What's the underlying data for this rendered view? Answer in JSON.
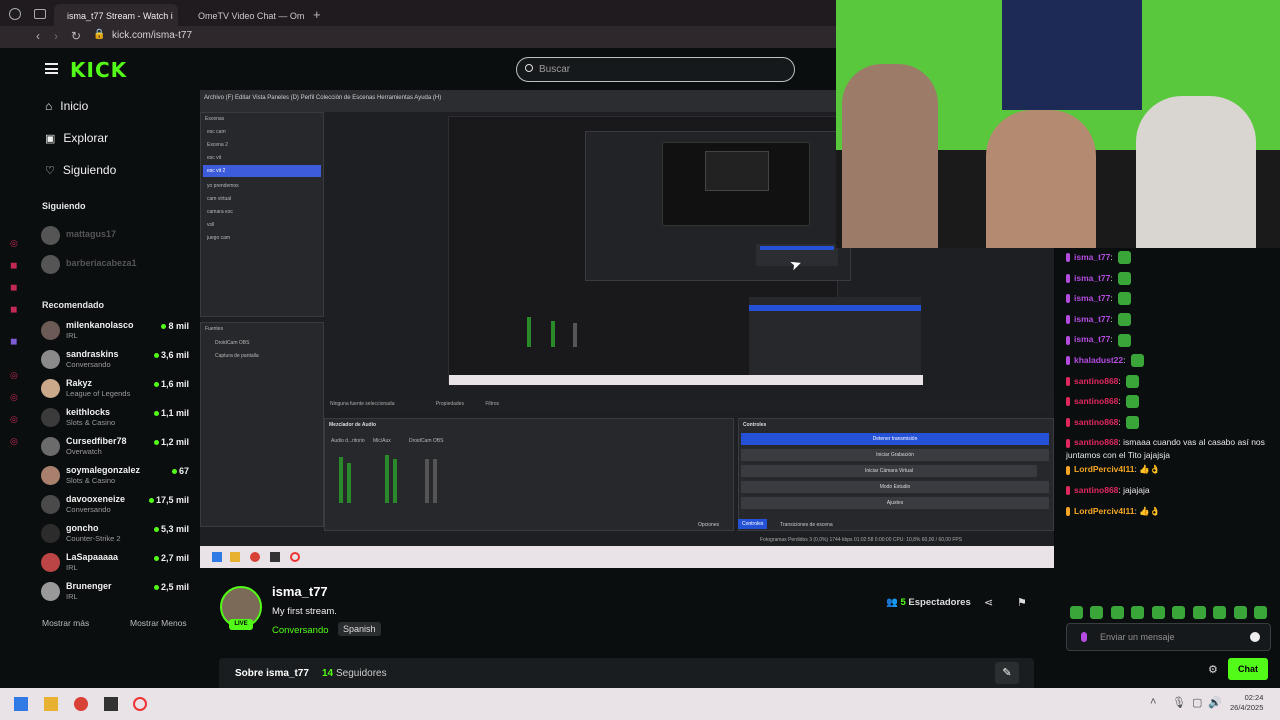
{
  "browser": {
    "tabs": [
      {
        "label": "isma_t77 Stream - Watch i",
        "active": true
      },
      {
        "label": "OmeTV Video Chat — Om",
        "active": false
      }
    ],
    "url": "kick.com/isma-t77"
  },
  "kick": {
    "search_placeholder": "Buscar",
    "nav": [
      {
        "label": "Inicio",
        "icon": "home-icon"
      },
      {
        "label": "Explorar",
        "icon": "compass-icon"
      },
      {
        "label": "Siguiendo",
        "icon": "heart-icon"
      }
    ],
    "following_title": "Siguiendo",
    "following": [
      "mattagus17",
      "barberiacabeza1"
    ],
    "recommended_title": "Recomendado",
    "recommended": [
      {
        "name": "milenkanolasco",
        "category": "IRL",
        "viewers": "8 mil"
      },
      {
        "name": "sandraskins",
        "category": "Conversando",
        "viewers": "3,6 mil"
      },
      {
        "name": "Rakyz",
        "category": "League of Legends",
        "viewers": "1,6 mil"
      },
      {
        "name": "keithlocks",
        "category": "Slots & Casino",
        "viewers": "1,1 mil"
      },
      {
        "name": "Cursedfiber78",
        "category": "Overwatch",
        "viewers": "1,2 mil"
      },
      {
        "name": "soymalegonzalez",
        "category": "Slots & Casino",
        "viewers": "67"
      },
      {
        "name": "davooxeneize",
        "category": "Conversando",
        "viewers": "17,5 mil"
      },
      {
        "name": "goncho",
        "category": "Counter-Strike 2",
        "viewers": "5,3 mil"
      },
      {
        "name": "LaSapaaaaa",
        "category": "IRL",
        "viewers": "2,7 mil"
      },
      {
        "name": "Brunenger",
        "category": "IRL",
        "viewers": "2,5 mil"
      }
    ],
    "show_more": "Mostrar más",
    "show_less": "Mostrar Menos",
    "accent": "#53fc18"
  },
  "obs": {
    "menu": "Archivo (F)   Editar   Vista   Paneles (D)   Perfil   Colección de Escenas   Herramientas   Ayuda (H)",
    "scenes_title": "Escenas",
    "scenes": [
      "esc cam",
      "Escena 2",
      "esc vit",
      "esc vit 2",
      "yo prendemos",
      "cam virtual",
      "camara esc",
      "vsll",
      "juego cam"
    ],
    "selected_scene": "esc vit 2",
    "sources_title": "Fuentes",
    "sources": [
      "DroidCam OBS",
      "Captura de pantalla"
    ],
    "no_source": "Ninguna fuente seleccionada",
    "properties": "Propiedades",
    "filters": "Filtros",
    "mixer_title": "Mezclador de Audio",
    "mixer_channels": [
      "Audio d...ritorio",
      "Mic/Aux",
      "DroidCam OBS"
    ],
    "controls_title": "Controles",
    "controls": [
      "Detener transmisión",
      "Iniciar Grabación",
      "Iniciar Cámara Virtual",
      "Modo Estudio",
      "Ajustes"
    ],
    "tabs": [
      "Controles",
      "Transiciones de escena"
    ],
    "options": "Opciones",
    "status": "Fotogramas Perdidos 3 (0,0%)    1744 kbps    01:02:58    0:00:00    CPU: 10,8%    60,00 / 60,00 FPS"
  },
  "chat": {
    "messages": [
      {
        "user": "isma_t77",
        "color": "#b44ce0",
        "text": "",
        "emote": true
      },
      {
        "user": "isma_t77",
        "color": "#b44ce0",
        "text": "",
        "emote": true
      },
      {
        "user": "isma_t77",
        "color": "#b44ce0",
        "text": "",
        "emote": true
      },
      {
        "user": "isma_t77",
        "color": "#b44ce0",
        "text": "",
        "emote": true
      },
      {
        "user": "isma_t77",
        "color": "#b44ce0",
        "text": "",
        "emote": true
      },
      {
        "user": "khaladust22",
        "color": "#b44ce0",
        "text": "",
        "emote": true
      },
      {
        "user": "santino868",
        "color": "#e0285f",
        "text": "",
        "emote": true
      },
      {
        "user": "santino868",
        "color": "#e0285f",
        "text": "",
        "emote": true
      },
      {
        "user": "santino868",
        "color": "#e0285f",
        "text": "",
        "emote": true
      },
      {
        "user": "santino868",
        "color": "#e0285f",
        "text": "ismaaa cuando vas al casabo así nos juntamos con el Tito jajajsja",
        "emote": false
      },
      {
        "user": "LordPerciv4l11",
        "color": "#f5a524",
        "text": "👍👌",
        "emote": false
      },
      {
        "user": "santino868",
        "color": "#e0285f",
        "text": "jajajaja",
        "emote": false
      },
      {
        "user": "LordPerciv4l11",
        "color": "#f5a524",
        "text": "👍👌",
        "emote": false
      }
    ],
    "input_placeholder": "Enviar un mensaje",
    "send_label": "Chat"
  },
  "stream": {
    "channel": "isma_t77",
    "title": "My first stream.",
    "category": "Conversando",
    "language": "Spanish",
    "live_label": "LIVE",
    "viewers_count": "5",
    "viewers_label": "Espectadores",
    "about_label": "Sobre isma_t77",
    "followers_count": "14",
    "followers_label": "Seguidores"
  },
  "os": {
    "time": "02:24",
    "date": "26/4/2025"
  }
}
